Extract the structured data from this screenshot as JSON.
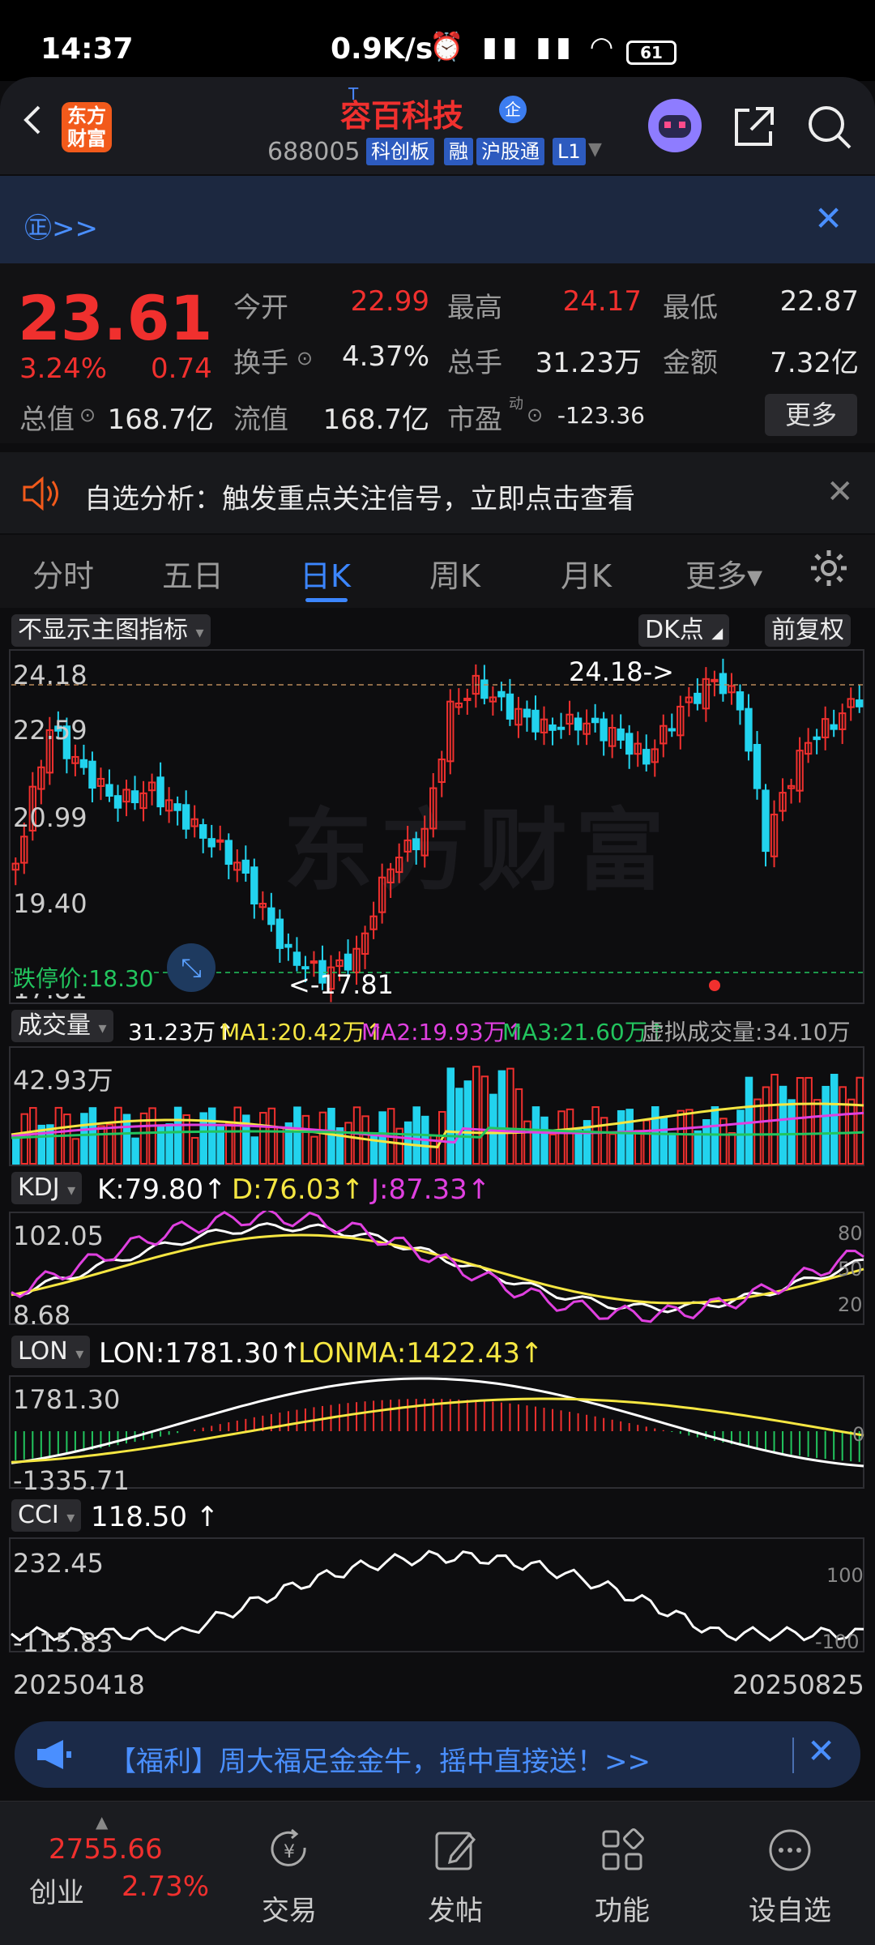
{
  "status_bar": {
    "time": "14:37",
    "speed": "0.9K/s",
    "battery": "61",
    "icons": "⏰ ▮▮ ▮▮ ◠"
  },
  "header": {
    "logo_text_1": "东方",
    "logo_text_2": "财富",
    "stock_name": "容百科技",
    "t_mark": "T",
    "qi_badge": "企",
    "stock_code": "688005",
    "tags": [
      "科创板",
      "融",
      "沪股通",
      "L1"
    ]
  },
  "notice": {
    "text": "㊣>>"
  },
  "quote": {
    "price": "23.61",
    "pct": "3.24%",
    "change": "0.74",
    "open_label": "今开",
    "open": "22.99",
    "high_label": "最高",
    "high": "24.17",
    "low_label": "最低",
    "low": "22.87",
    "turnover_label": "换手",
    "turnover": "4.37%",
    "volume_label": "总手",
    "volume": "31.23万",
    "amount_label": "金额",
    "amount": "7.32亿",
    "mktcap_label": "总值",
    "mktcap": "168.7亿",
    "float_label": "流值",
    "float_cap": "168.7亿",
    "pe_label": "市盈",
    "pe_sup": "动",
    "pe": "-123.36",
    "more": "更多"
  },
  "alert": {
    "text": "自选分析：触发重点关注信号，立即点击查看"
  },
  "tabs": [
    "分时",
    "五日",
    "日K",
    "周K",
    "月K",
    "更多▾"
  ],
  "active_tab": 2,
  "chart": {
    "indicator_select": "不显示主图指标",
    "dk_button": "DK点",
    "fq_button": "前复权",
    "y_labels": [
      "24.18",
      "22.59",
      "20.99",
      "19.40",
      "17.81"
    ],
    "high_marker": "24.18->",
    "low_marker": "<-17.81",
    "stop_price": "跌停价:18.30",
    "volume": {
      "name": "成交量",
      "value": "31.23万",
      "ma1": "MA1:20.42万",
      "ma2": "MA2:19.93万",
      "ma3": "MA3:21.60万",
      "virtual": "虚拟成交量:34.10万",
      "axis_max": "42.93万"
    },
    "kdj": {
      "name": "KDJ",
      "k": "K:79.80",
      "d": "D:76.03",
      "j": "J:87.33",
      "axis_max": "102.05",
      "axis_min": "8.68",
      "ticks": [
        "80",
        "50",
        "20"
      ]
    },
    "lon": {
      "name": "LON",
      "lon": "LON:1781.30",
      "lonma": "LONMA:1422.43",
      "axis_max": "1781.30",
      "axis_min": "-1335.71",
      "tick": "0"
    },
    "cci": {
      "name": "CCI",
      "value": "118.50",
      "axis_max": "232.45",
      "axis_min": "-115.83",
      "ticks": [
        "100",
        "-100"
      ]
    },
    "date_start": "20250418",
    "date_end": "20250825",
    "watermark": "东方财富",
    "up_color": "#f0302e",
    "down_color": "#22d3ee"
  },
  "promo": {
    "text": "【福利】周大福足金金牛，摇中直接送！>>"
  },
  "bottom_nav": {
    "index_value": "2755.66",
    "index_name": "创业",
    "index_pct": "2.73%",
    "items": [
      "交易",
      "发帖",
      "功能",
      "设自选"
    ]
  }
}
